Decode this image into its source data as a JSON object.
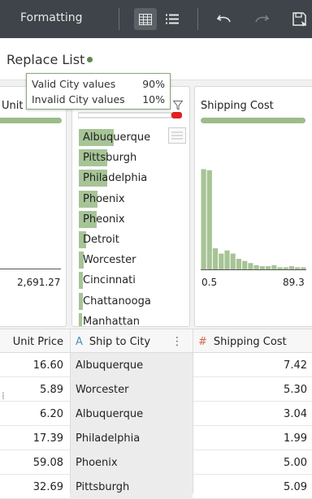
{
  "toolbar": {
    "formatting_label": "Formatting",
    "icons": [
      "table-view-icon",
      "list-view-icon",
      "undo-icon",
      "redo-icon",
      "save-icon"
    ]
  },
  "header": {
    "title": "Replace List"
  },
  "tooltip": {
    "rows": [
      {
        "label": "Valid City values",
        "value": "90%"
      },
      {
        "label": "Invalid City values",
        "value": "10%"
      }
    ]
  },
  "profiles": {
    "unit_price": {
      "title": "Unit Pr",
      "axis_max": "2,691.27"
    },
    "city": {
      "valid_fraction": 0.9,
      "invalid_fraction": 0.1,
      "values": [
        {
          "name": "Albuquerque",
          "fraction": 0.55
        },
        {
          "name": "Pittsburgh",
          "fraction": 0.45
        },
        {
          "name": "Philadelphia",
          "fraction": 0.45
        },
        {
          "name": "Phoenix",
          "fraction": 0.3
        },
        {
          "name": "Pheonix",
          "fraction": 0.28
        },
        {
          "name": "Detroit",
          "fraction": 0.12
        },
        {
          "name": "Worcester",
          "fraction": 0.08
        },
        {
          "name": "Cincinnati",
          "fraction": 0.06
        },
        {
          "name": "Chattanooga",
          "fraction": 0.06
        },
        {
          "name": "Manhattan",
          "fraction": 0.05
        }
      ]
    },
    "shipping_cost": {
      "title": "Shipping Cost",
      "axis_min": "0.5",
      "axis_max": "89.3",
      "histogram": [
        0.95,
        0.94,
        0.2,
        0.15,
        0.18,
        0.15,
        0.1,
        0.08,
        0.06,
        0.04,
        0.03,
        0.03,
        0.04,
        0.02,
        0.02,
        0.03,
        0.02,
        0.02
      ]
    }
  },
  "colors": {
    "toolbar_bg": "#3e4449",
    "valid_green": "#9cbc8a",
    "invalid_red": "#e02020",
    "city_type_icon": "#4a90b8",
    "cost_type_icon": "#d0664a"
  },
  "grid": {
    "columns": [
      {
        "label": "Unit Price",
        "type_icon": ""
      },
      {
        "label": "Ship to City",
        "type_icon": "A"
      },
      {
        "label": "Shipping Cost",
        "type_icon": "#"
      }
    ],
    "rows": [
      {
        "unit_price": "16.60",
        "city": "Albuquerque",
        "shipping": "7.42"
      },
      {
        "unit_price": "5.89",
        "city": "Worcester",
        "shipping": "5.30"
      },
      {
        "unit_price": "6.20",
        "city": "Albuquerque",
        "shipping": "3.04"
      },
      {
        "unit_price": "17.39",
        "city": "Philadelphia",
        "shipping": "1.99"
      },
      {
        "unit_price": "59.08",
        "city": "Phoenix",
        "shipping": "5.00"
      },
      {
        "unit_price": "32.69",
        "city": "Pittsburgh",
        "shipping": "5.09"
      }
    ]
  }
}
